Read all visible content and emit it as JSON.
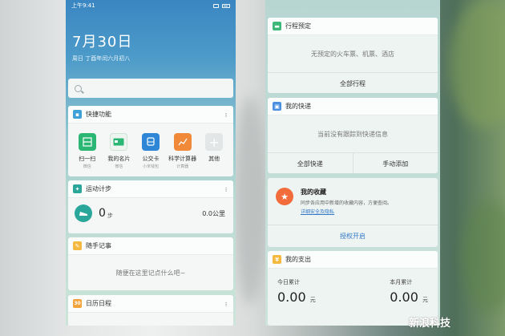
{
  "left": {
    "status_time": "上午9:41",
    "date_big": "7月30日",
    "date_sub": "周日 丁酉年闰六月初八",
    "search_icon": "search-icon",
    "quick": {
      "title": "快捷功能",
      "items": [
        {
          "label": "扫一扫",
          "sub": "微信",
          "color": "#2bb673",
          "icon": "scan-icon"
        },
        {
          "label": "我的名片",
          "sub": "微信",
          "color": "#2bb673",
          "icon": "card-icon"
        },
        {
          "label": "公交卡",
          "sub": "小米钱包",
          "color": "#2f86d6",
          "icon": "bus-icon"
        },
        {
          "label": "科学计算器",
          "sub": "计算器",
          "color": "#f08a3a",
          "icon": "chart-icon"
        },
        {
          "label": "其他",
          "sub": "",
          "color": "#e3e6e6",
          "icon": "plus-icon"
        }
      ]
    },
    "steps": {
      "title": "运动计步",
      "count": "0",
      "unit": "步",
      "distance": "0.0公里"
    },
    "notes": {
      "title": "随手记事",
      "placeholder": "随便在这里记点什么吧~"
    },
    "calendar": {
      "title": "日历日程",
      "badge": "30"
    }
  },
  "right": {
    "trip": {
      "title": "行程预定",
      "empty": "无预定的火车票、机票、酒店",
      "action": "全部行程"
    },
    "express": {
      "title": "我的快递",
      "empty": "当前没有跟踪到快递信息",
      "action_all": "全部快递",
      "action_add": "手动添加"
    },
    "favorites": {
      "title": "我的收藏",
      "desc": "同步各应用中新增的收藏内容，方便查阅。",
      "link": "详细安全及隐私",
      "action": "授权开启"
    },
    "spending": {
      "title": "我的支出",
      "today_label": "今日累计",
      "today_value": "0.00",
      "today_unit": "元",
      "month_label": "本月累计",
      "month_value": "0.00",
      "month_unit": "元"
    }
  },
  "watermark": "新浪科技",
  "colors": {
    "accent_blue": "#3478c6",
    "green": "#2bb673",
    "orange": "#f08a3a",
    "steps_teal": "#2aa79a",
    "fav_orange": "#f26b3a"
  }
}
